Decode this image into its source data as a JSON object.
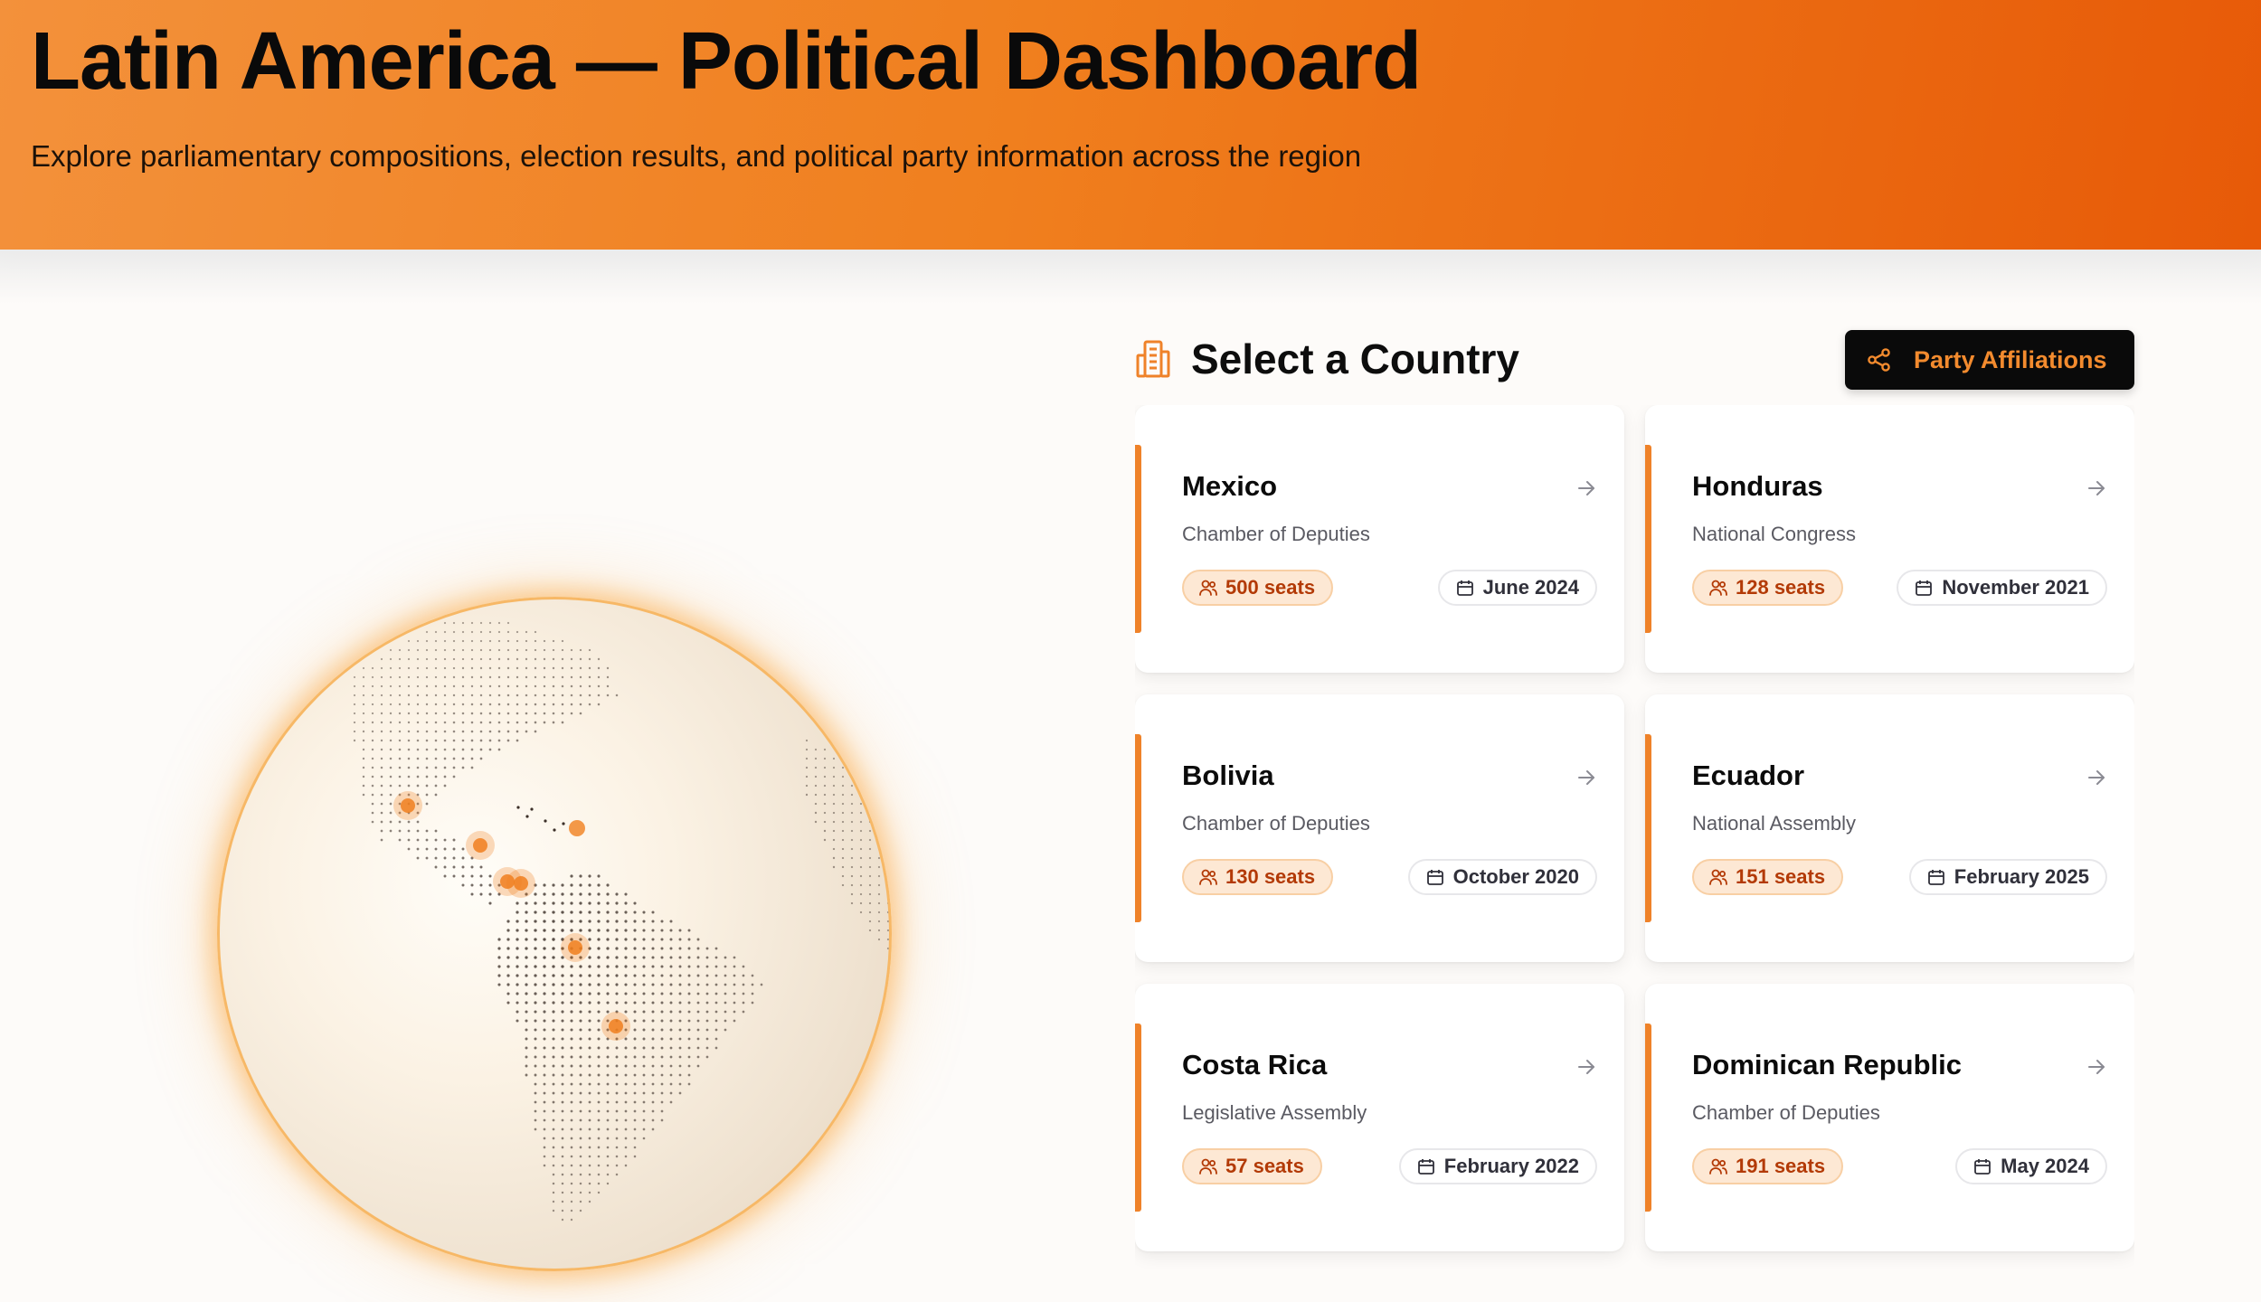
{
  "header": {
    "title": "Latin America — Political Dashboard",
    "subtitle": "Explore parliamentary compositions, election results, and political party information across the region"
  },
  "globe": {
    "markers": [
      "Mexico",
      "Honduras",
      "Costa Rica",
      "Dominican Republic",
      "Ecuador",
      "Bolivia"
    ],
    "marker_color": "#f07f1e"
  },
  "selection": {
    "title": "Select a Country",
    "affiliations_button": "Party Affiliations"
  },
  "countries": [
    {
      "name": "Mexico",
      "chamber": "Chamber of Deputies",
      "seats": "500 seats",
      "date": "June 2024"
    },
    {
      "name": "Honduras",
      "chamber": "National Congress",
      "seats": "128 seats",
      "date": "November 2021"
    },
    {
      "name": "Bolivia",
      "chamber": "Chamber of Deputies",
      "seats": "130 seats",
      "date": "October 2020"
    },
    {
      "name": "Ecuador",
      "chamber": "National Assembly",
      "seats": "151 seats",
      "date": "February 2025"
    },
    {
      "name": "Costa Rica",
      "chamber": "Legislative Assembly",
      "seats": "57 seats",
      "date": "February 2022"
    },
    {
      "name": "Dominican Republic",
      "chamber": "Chamber of Deputies",
      "seats": "191 seats",
      "date": "May 2024"
    }
  ],
  "colors": {
    "accent": "#ef8229",
    "header_start": "#f3913b",
    "header_end": "#e75a08",
    "seat_badge_text": "#b33a06"
  }
}
